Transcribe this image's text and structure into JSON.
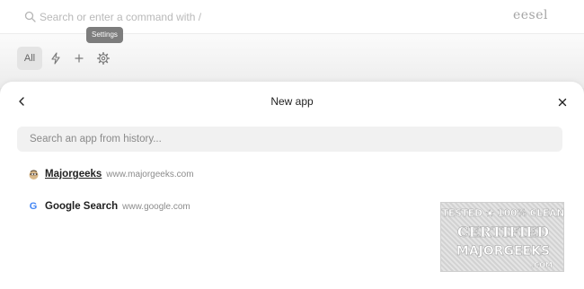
{
  "topbar": {
    "search_placeholder": "Search or enter a command with /",
    "brand": "eesel"
  },
  "toolbar": {
    "all_label": "All",
    "tooltip": "Settings",
    "icons": [
      "bolt-icon",
      "plus-icon",
      "gear-icon"
    ]
  },
  "panel": {
    "title": "New app",
    "search_placeholder": "Search an app from history...",
    "apps": [
      {
        "name": "Majorgeeks",
        "url": "www.majorgeeks.com",
        "icon": "majorgeeks-favicon"
      },
      {
        "name": "Google Search",
        "url": "www.google.com",
        "icon": "google-favicon"
      }
    ]
  },
  "watermark": {
    "line1": "TESTED ★ 100% CLEAN",
    "line2": "CERTIFIED",
    "line3": "MAJORGEEKS",
    "line4": ".COM"
  },
  "colors": {
    "google_blue": "#4285f4",
    "tooltip_bg": "#7d7d7d",
    "search_bg": "#f1f1f1"
  }
}
